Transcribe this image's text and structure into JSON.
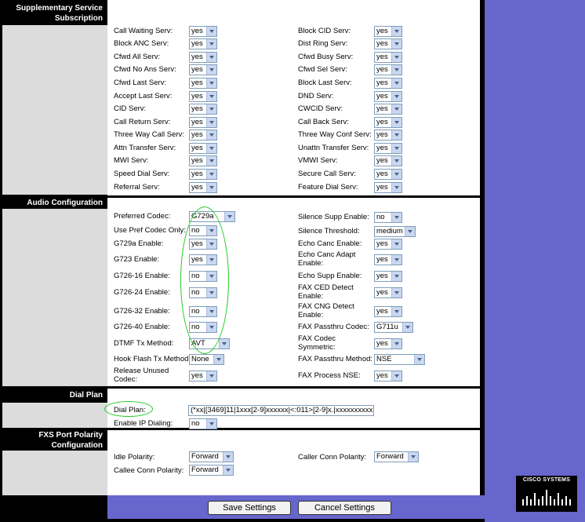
{
  "sections": {
    "supplementary": "Supplementary Service Subscription",
    "audio": "Audio Configuration",
    "dialplan": "Dial Plan",
    "fxs": "FXS Port Polarity Configuration"
  },
  "supp_left": [
    {
      "label": "Call Waiting Serv:",
      "value": "yes"
    },
    {
      "label": "Block ANC Serv:",
      "value": "yes"
    },
    {
      "label": "Cfwd All Serv:",
      "value": "yes"
    },
    {
      "label": "Cfwd No Ans Serv:",
      "value": "yes"
    },
    {
      "label": "Cfwd Last Serv:",
      "value": "yes"
    },
    {
      "label": "Accept Last Serv:",
      "value": "yes"
    },
    {
      "label": "CID Serv:",
      "value": "yes"
    },
    {
      "label": "Call Return Serv:",
      "value": "yes"
    },
    {
      "label": "Three Way Call Serv:",
      "value": "yes"
    },
    {
      "label": "Attn Transfer Serv:",
      "value": "yes"
    },
    {
      "label": "MWI Serv:",
      "value": "yes"
    },
    {
      "label": "Speed Dial Serv:",
      "value": "yes"
    },
    {
      "label": "Referral Serv:",
      "value": "yes"
    }
  ],
  "supp_right": [
    {
      "label": "Block CID Serv:",
      "value": "yes"
    },
    {
      "label": "Dist Ring Serv:",
      "value": "yes"
    },
    {
      "label": "Cfwd Busy Serv:",
      "value": "yes"
    },
    {
      "label": "Cfwd Sel Serv:",
      "value": "yes"
    },
    {
      "label": "Block Last Serv:",
      "value": "yes"
    },
    {
      "label": "DND Serv:",
      "value": "yes"
    },
    {
      "label": "CWCID Serv:",
      "value": "yes"
    },
    {
      "label": "Call Back Serv:",
      "value": "yes"
    },
    {
      "label": "Three Way Conf Serv:",
      "value": "yes"
    },
    {
      "label": "Unattn Transfer Serv:",
      "value": "yes"
    },
    {
      "label": "VMWI Serv:",
      "value": "yes"
    },
    {
      "label": "Secure Call Serv:",
      "value": "yes"
    },
    {
      "label": "Feature Dial Serv:",
      "value": "yes"
    }
  ],
  "audio_left": [
    {
      "label": "Preferred Codec:",
      "value": "G729a"
    },
    {
      "label": "Use Pref Codec Only:",
      "value": "no"
    },
    {
      "label": "G729a Enable:",
      "value": "yes"
    },
    {
      "label": "G723 Enable:",
      "value": "yes"
    },
    {
      "label": "G726-16 Enable:",
      "value": "no"
    },
    {
      "label": "G726-24 Enable:",
      "value": "no"
    },
    {
      "label": "G726-32 Enable:",
      "value": "no"
    },
    {
      "label": "G726-40 Enable:",
      "value": "no"
    },
    {
      "label": "DTMF Tx Method:",
      "value": "AVT"
    },
    {
      "label": "Hook Flash Tx Method:",
      "value": "None"
    },
    {
      "label": "Release Unused Codec:",
      "value": "yes"
    }
  ],
  "audio_right": [
    {
      "label": "Silence Supp Enable:",
      "value": "no"
    },
    {
      "label": "Silence Threshold:",
      "value": "medium"
    },
    {
      "label": "Echo Canc Enable:",
      "value": "yes"
    },
    {
      "label": "Echo Canc Adapt Enable:",
      "value": "yes"
    },
    {
      "label": "Echo Supp Enable:",
      "value": "yes"
    },
    {
      "label": "FAX CED Detect Enable:",
      "value": "yes"
    },
    {
      "label": "FAX CNG Detect Enable:",
      "value": "yes"
    },
    {
      "label": "FAX Passthru Codec:",
      "value": "G711u"
    },
    {
      "label": "FAX Codec Symmetric:",
      "value": "yes"
    },
    {
      "label": "FAX Passthru Method:",
      "value": "NSE"
    },
    {
      "label": "FAX Process NSE:",
      "value": "yes"
    }
  ],
  "dial": {
    "plan_label": "Dial Plan:",
    "plan_value": "(*xx|[3469]11|1xxx[2-9]xxxxxx|<:011>[2-9]x.|xxxxxxxxxx.",
    "ip_label": "Enable IP Dialing:",
    "ip_value": "no"
  },
  "fxs": {
    "idle_label": "Idle Polarity:",
    "idle_value": "Forward",
    "caller_label": "Caller Conn Polarity:",
    "caller_value": "Forward",
    "callee_label": "Callee Conn Polarity:",
    "callee_value": "Forward"
  },
  "buttons": {
    "save": "Save Settings",
    "cancel": "Cancel Settings"
  },
  "brand": {
    "name": "CISCO SYSTEMS"
  },
  "colors": {
    "purple": "#6666cc",
    "highlight": "#22cc22",
    "panel_gray": "#dcdcdc"
  }
}
